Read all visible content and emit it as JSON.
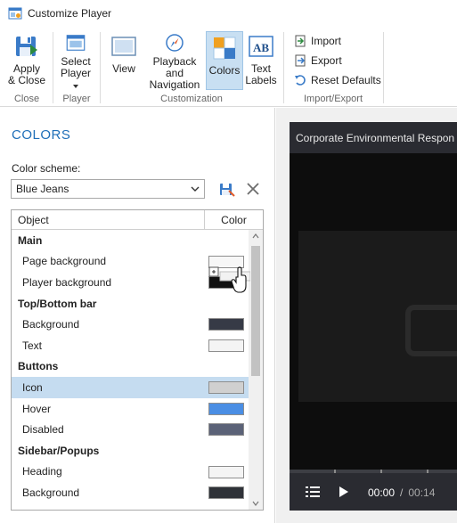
{
  "window": {
    "title": "Customize Player"
  },
  "ribbon": {
    "apply_close": "Apply\n& Close",
    "apply_line1": "Apply",
    "apply_line2": "& Close",
    "select_line1": "Select",
    "select_line2": "Player",
    "view": "View",
    "playback_line1": "Playback and",
    "playback_line2": "Navigation",
    "colors": "Colors",
    "text_line1": "Text",
    "text_line2": "Labels",
    "import": "Import",
    "export": "Export",
    "reset": "Reset Defaults",
    "groups": {
      "close": "Close",
      "player": "Player",
      "customization": "Customization",
      "import_export": "Import/Export"
    }
  },
  "colors_panel": {
    "title": "COLORS",
    "scheme_label": "Color scheme:",
    "scheme_value": "Blue Jeans",
    "table": {
      "col_object": "Object",
      "col_color": "Color",
      "rows": [
        {
          "kind": "group",
          "label": "Main"
        },
        {
          "kind": "item",
          "label": "Page background",
          "color": "#f7f7f7"
        },
        {
          "kind": "item",
          "label": "Player background",
          "color": "#111111"
        },
        {
          "kind": "group",
          "label": "Top/Bottom bar"
        },
        {
          "kind": "item",
          "label": "Background",
          "color": "#363a46"
        },
        {
          "kind": "item",
          "label": "Text",
          "color": "#f4f4f4"
        },
        {
          "kind": "group",
          "label": "Buttons"
        },
        {
          "kind": "item",
          "label": "Icon",
          "color": "#d0d0d0",
          "selected": true
        },
        {
          "kind": "item",
          "label": "Hover",
          "color": "#4a8ee4"
        },
        {
          "kind": "item",
          "label": "Disabled",
          "color": "#5b6277"
        },
        {
          "kind": "group",
          "label": "Sidebar/Popups"
        },
        {
          "kind": "item",
          "label": "Heading",
          "color": "#f4f4f4"
        },
        {
          "kind": "item",
          "label": "Background",
          "color": "#2f3238"
        }
      ]
    }
  },
  "preview": {
    "title": "Corporate Environmental Respon",
    "time_current": "00:00",
    "time_separator": "/",
    "time_total": "00:14"
  },
  "accent": "#1f6fb8",
  "selection": "#c5dcf0"
}
